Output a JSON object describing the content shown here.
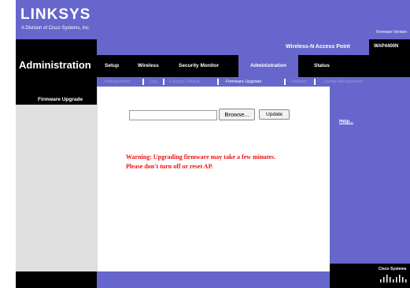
{
  "header": {
    "logo": "LINKSYS",
    "logo_subtitle": "A Division of Cisco Systems, Inc.",
    "firmware_version": "Firmware Version"
  },
  "page_title": "Administration",
  "product": {
    "name": "Wireless-N Access Point",
    "model": "WAP4400N"
  },
  "tabs": [
    {
      "label": "Setup"
    },
    {
      "label": "Wireless"
    },
    {
      "label": "Security Monitor"
    },
    {
      "label": "Administration",
      "active": true
    },
    {
      "label": "Status"
    }
  ],
  "subtabs": [
    {
      "label": "Management"
    },
    {
      "label": "Log"
    },
    {
      "label": "Factory Default"
    },
    {
      "label": "Firmware Upgrade",
      "active": true
    },
    {
      "label": "Reboot"
    },
    {
      "label": "Config Management"
    }
  ],
  "left_panel": {
    "title": "Firmware Upgrade"
  },
  "form": {
    "file_value": "",
    "browse_label": "Browse...",
    "update_label": "Update"
  },
  "warning": {
    "line1": "Warning: Upgrading firmware may take a few minutes.",
    "line2": "Please don't turn off or reset AP."
  },
  "help": {
    "link": "Help..."
  },
  "footer": {
    "brand": "Cisco Systems"
  },
  "colors": {
    "accent": "#6666cc",
    "dark": "#000000",
    "warning": "#ee1111"
  }
}
